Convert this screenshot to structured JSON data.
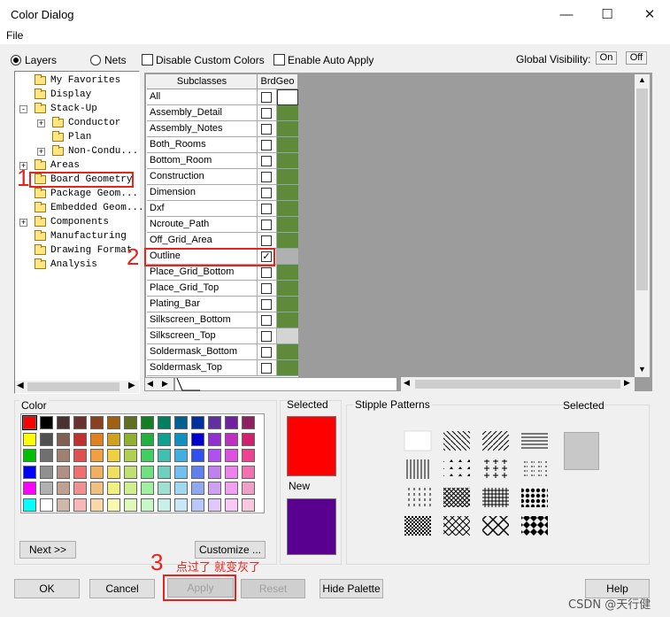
{
  "window": {
    "title": "Color Dialog",
    "min_icon": "minimize-icon",
    "max_icon": "maximize-icon",
    "close_icon": "close-icon"
  },
  "menu": {
    "file": "File"
  },
  "toolbar": {
    "layers": "Layers",
    "nets": "Nets",
    "layers_selected": true,
    "disable_custom_colors": "Disable Custom Colors",
    "enable_auto_apply": "Enable Auto Apply",
    "global_visibility": "Global Visibility:",
    "on": "On",
    "off": "Off"
  },
  "tree": [
    {
      "label": "My Favorites",
      "level": 0,
      "expander": ""
    },
    {
      "label": "Display",
      "level": 0,
      "expander": ""
    },
    {
      "label": "Stack-Up",
      "level": 0,
      "expander": "-"
    },
    {
      "label": "Conductor",
      "level": 1,
      "expander": "+"
    },
    {
      "label": "Plan",
      "level": 1,
      "expander": ""
    },
    {
      "label": "Non-Condu...",
      "level": 1,
      "expander": "+"
    },
    {
      "label": "Areas",
      "level": 0,
      "expander": "+"
    },
    {
      "label": "Board Geometry",
      "level": 0,
      "expander": ""
    },
    {
      "label": "Package Geom...",
      "level": 0,
      "expander": ""
    },
    {
      "label": "Embedded Geom...",
      "level": 0,
      "expander": ""
    },
    {
      "label": "Components",
      "level": 0,
      "expander": "+"
    },
    {
      "label": "Manufacturing",
      "level": 0,
      "expander": ""
    },
    {
      "label": "Drawing Format",
      "level": 0,
      "expander": ""
    },
    {
      "label": "Analysis",
      "level": 0,
      "expander": ""
    }
  ],
  "grid": {
    "col_subclasses": "Subclasses",
    "col_brdgeo": "BrdGeo",
    "rows": [
      {
        "name": "All",
        "checked": false,
        "color": "#ffffff"
      },
      {
        "name": "Assembly_Detail",
        "checked": false,
        "color": "#5f8a3a"
      },
      {
        "name": "Assembly_Notes",
        "checked": false,
        "color": "#5f8a3a"
      },
      {
        "name": "Both_Rooms",
        "checked": false,
        "color": "#5f8a3a"
      },
      {
        "name": "Bottom_Room",
        "checked": false,
        "color": "#5f8a3a"
      },
      {
        "name": "Construction",
        "checked": false,
        "color": "#5f8a3a"
      },
      {
        "name": "Dimension",
        "checked": false,
        "color": "#5f8a3a"
      },
      {
        "name": "Dxf",
        "checked": false,
        "color": "#5f8a3a"
      },
      {
        "name": "Ncroute_Path",
        "checked": false,
        "color": "#5f8a3a"
      },
      {
        "name": "Off_Grid_Area",
        "checked": false,
        "color": "#5f8a3a"
      },
      {
        "name": "Outline",
        "checked": true,
        "color": "#b0b0b0"
      },
      {
        "name": "Place_Grid_Bottom",
        "checked": false,
        "color": "#5f8a3a"
      },
      {
        "name": "Place_Grid_Top",
        "checked": false,
        "color": "#5f8a3a"
      },
      {
        "name": "Plating_Bar",
        "checked": false,
        "color": "#5f8a3a"
      },
      {
        "name": "Silkscreen_Bottom",
        "checked": false,
        "color": "#5f8a3a"
      },
      {
        "name": "Silkscreen_Top",
        "checked": false,
        "color": "#d4d4d4"
      },
      {
        "name": "Soldermask_Bottom",
        "checked": false,
        "color": "#5f8a3a"
      },
      {
        "name": "Soldermask_Top",
        "checked": false,
        "color": "#5f8a3a"
      }
    ]
  },
  "color_panel": {
    "title": "Color",
    "selected": "Selected",
    "new": "New",
    "selected_color": "#ff0000",
    "new_color": "#5a0090",
    "next": "Next >>",
    "customize": "Customize ...",
    "palette": [
      [
        "#ff0000",
        "#000000",
        "#4a3030",
        "#6a3030",
        "#8a4020",
        "#a06010",
        "#607020",
        "#108020",
        "#008060",
        "#006090",
        "#0030a0",
        "#6030a0",
        "#7020a0",
        "#902060"
      ],
      [
        "#ffff00",
        "#505050",
        "#806050",
        "#c03030",
        "#e08020",
        "#d0a020",
        "#90b030",
        "#20b040",
        "#10a090",
        "#1090c0",
        "#0000d0",
        "#9030d0",
        "#c030c0",
        "#d02070"
      ],
      [
        "#00c000",
        "#707070",
        "#a08070",
        "#e05050",
        "#f0a040",
        "#f0d040",
        "#b0d050",
        "#40d060",
        "#40c0b0",
        "#40b0e0",
        "#3050f0",
        "#b050f0",
        "#e050e0",
        "#f04090"
      ],
      [
        "#0000ff",
        "#909090",
        "#b09080",
        "#f07070",
        "#f0b060",
        "#f0e060",
        "#c0e070",
        "#70e080",
        "#70d0c0",
        "#70c0f0",
        "#6080f0",
        "#c080f0",
        "#f080f0",
        "#f070b0"
      ],
      [
        "#ff00ff",
        "#b0b0b0",
        "#c0a090",
        "#f09090",
        "#f0c080",
        "#f0f080",
        "#d0f090",
        "#a0f0a0",
        "#a0e0d0",
        "#a0d8f0",
        "#90a8f0",
        "#d0a0f0",
        "#f0a0f0",
        "#f0a0c8"
      ],
      [
        "#00ffff",
        "#ffffff",
        "#d0b8a8",
        "#f8b8b8",
        "#f8d8a8",
        "#f8f8b0",
        "#e0f8b8",
        "#c8f8c8",
        "#c8f0e8",
        "#c8e8f8",
        "#b8c8f8",
        "#e0c8f8",
        "#f8c8f8",
        "#f8c8e0"
      ]
    ]
  },
  "stipple": {
    "title": "Stipple Patterns",
    "selected": "Selected"
  },
  "buttons": {
    "ok": "OK",
    "cancel": "Cancel",
    "apply": "Apply",
    "reset": "Reset",
    "hide_palette": "Hide Palette",
    "help": "Help"
  },
  "annotations": {
    "n1": "1",
    "n2": "2",
    "n3": "3",
    "note": "点过了 就变灰了"
  },
  "watermark": "CSDN @天行健"
}
